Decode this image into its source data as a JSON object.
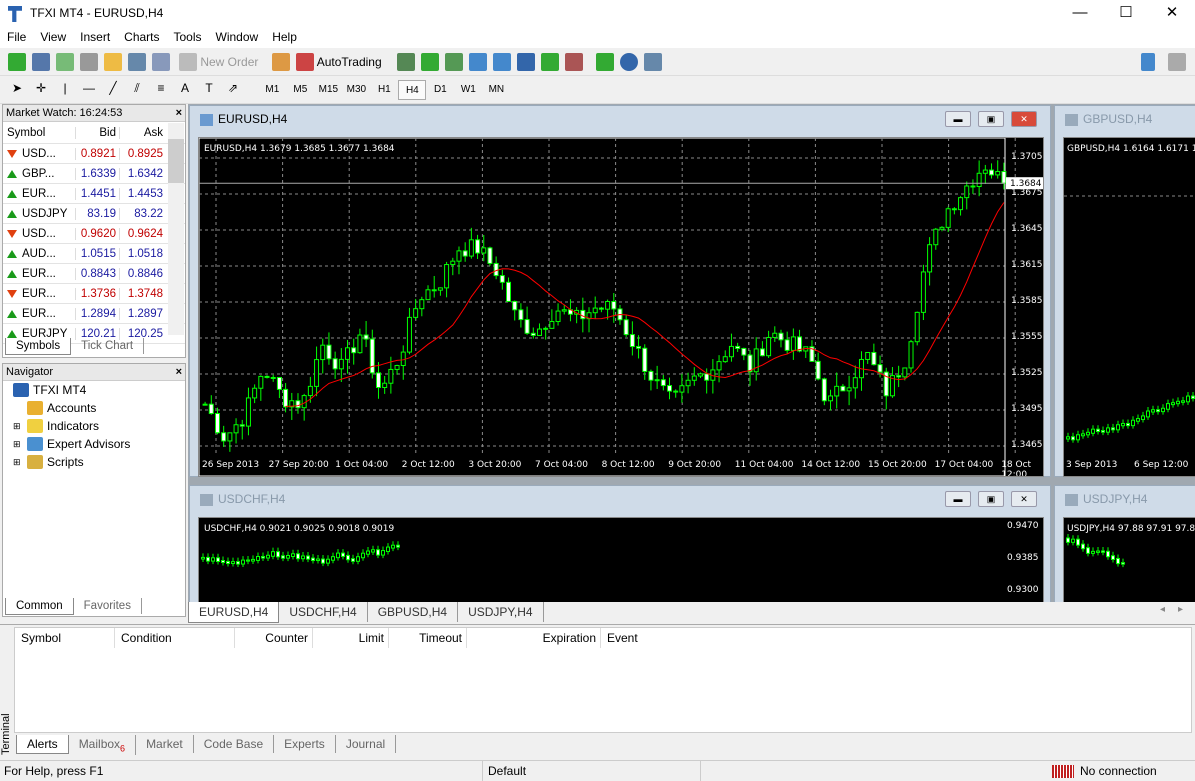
{
  "window": {
    "title": "TFXI MT4 - EURUSD,H4",
    "minimize": "—",
    "maximize": "☐",
    "close": "✕"
  },
  "menu": [
    "File",
    "View",
    "Insert",
    "Charts",
    "Tools",
    "Window",
    "Help"
  ],
  "toolbar": {
    "new_order": "New Order",
    "autotrading": "AutoTrading",
    "timeframes": [
      "M1",
      "M5",
      "M15",
      "M30",
      "H1",
      "H4",
      "D1",
      "W1",
      "MN"
    ],
    "selected_timeframe": "H4"
  },
  "market_watch": {
    "title": "Market Watch: 16:24:53",
    "columns": [
      "Symbol",
      "Bid",
      "Ask"
    ],
    "rows": [
      {
        "symbol": "USD...",
        "bid": "0.8921",
        "ask": "0.8925",
        "dir": "down"
      },
      {
        "symbol": "GBP...",
        "bid": "1.6339",
        "ask": "1.6342",
        "dir": "up"
      },
      {
        "symbol": "EUR...",
        "bid": "1.4451",
        "ask": "1.4453",
        "dir": "up"
      },
      {
        "symbol": "USDJPY",
        "bid": "83.19",
        "ask": "83.22",
        "dir": "up"
      },
      {
        "symbol": "USD...",
        "bid": "0.9620",
        "ask": "0.9624",
        "dir": "down"
      },
      {
        "symbol": "AUD...",
        "bid": "1.0515",
        "ask": "1.0518",
        "dir": "up"
      },
      {
        "symbol": "EUR...",
        "bid": "0.8843",
        "ask": "0.8846",
        "dir": "up"
      },
      {
        "symbol": "EUR...",
        "bid": "1.3736",
        "ask": "1.3748",
        "dir": "down"
      },
      {
        "symbol": "EUR...",
        "bid": "1.2894",
        "ask": "1.2897",
        "dir": "up"
      },
      {
        "symbol": "EURJPY",
        "bid": "120.21",
        "ask": "120.25",
        "dir": "up"
      }
    ],
    "tabs": [
      "Symbols",
      "Tick Chart"
    ]
  },
  "navigator": {
    "title": "Navigator",
    "root": "TFXI MT4",
    "items": [
      "Accounts",
      "Indicators",
      "Expert Advisors",
      "Scripts"
    ],
    "tabs": [
      "Common",
      "Favorites"
    ]
  },
  "charts": {
    "eurusd": {
      "title": "EURUSD,H4",
      "info": "EURUSD,H4  1.3679 1.3685 1.3677 1.3684",
      "price_labels": [
        "1.3705",
        "1.3675",
        "1.3645",
        "1.3615",
        "1.3585",
        "1.3555",
        "1.3525",
        "1.3495",
        "1.3465"
      ],
      "current_price": "1.3684",
      "time_labels": [
        "26 Sep 2013",
        "27 Sep 20:00",
        "1 Oct 04:00",
        "2 Oct 12:00",
        "3 Oct 20:00",
        "7 Oct 04:00",
        "8 Oct 12:00",
        "9 Oct 20:00",
        "11 Oct 04:00",
        "14 Oct 12:00",
        "15 Oct 20:00",
        "17 Oct 04:00",
        "18 Oct 12:00"
      ],
      "close_path": [
        1.35,
        1.3472,
        1.349,
        1.353,
        1.3505,
        1.35,
        1.355,
        1.353,
        1.356,
        1.351,
        1.354,
        1.359,
        1.36,
        1.363,
        1.363,
        1.361,
        1.357,
        1.356,
        1.358,
        1.357,
        1.358,
        1.358,
        1.355,
        1.352,
        1.35,
        1.352,
        1.353,
        1.355,
        1.353,
        1.356,
        1.355,
        1.354,
        1.35,
        1.352,
        1.354,
        1.351,
        1.354,
        1.362,
        1.366,
        1.368,
        1.37,
        1.3684
      ],
      "colors": {
        "bull": "#00ff00",
        "bear": "#00ff00",
        "ma": "#ff0000",
        "grid": "#8a8a8a"
      }
    },
    "gbpusd": {
      "title": "GBPUSD,H4",
      "info": "GBPUSD,H4  1.6164 1.6171 1",
      "time_labels": [
        "3 Sep 2013",
        "6 Sep 12:00"
      ]
    },
    "usdchf": {
      "title": "USDCHF,H4",
      "info": "USDCHF,H4  0.9021 0.9025 0.9018 0.9019",
      "price_labels": [
        "0.9470",
        "0.9385",
        "0.9300"
      ]
    },
    "usdjpy": {
      "title": "USDJPY,H4",
      "info": "USDJPY,H4  97.88 97.91 97.8"
    },
    "tabs": [
      "EURUSD,H4",
      "USDCHF,H4",
      "GBPUSD,H4",
      "USDJPY,H4"
    ]
  },
  "terminal": {
    "label": "Terminal",
    "columns": [
      "Symbol",
      "Condition",
      "Counter",
      "Limit",
      "Timeout",
      "Expiration",
      "Event"
    ],
    "tabs": [
      "Alerts",
      "Mailbox",
      "Market",
      "Code Base",
      "Experts",
      "Journal"
    ],
    "mailbox_count": "6"
  },
  "status": {
    "help": "For Help, press F1",
    "profile": "Default",
    "connection": "No connection"
  }
}
